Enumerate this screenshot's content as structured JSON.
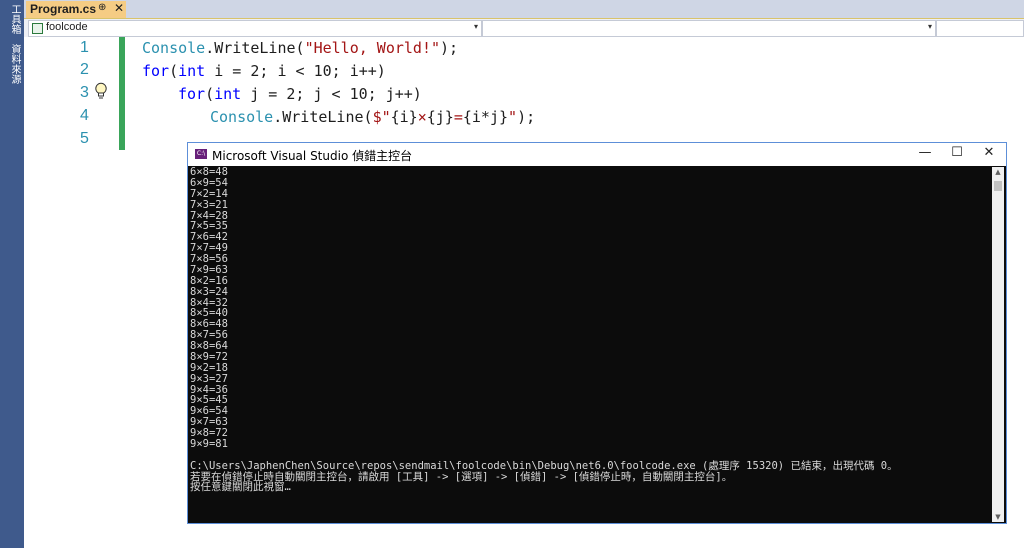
{
  "side_toolbar": {
    "items": [
      "工具箱",
      "資料來源"
    ]
  },
  "tab": {
    "title": "Program.cs",
    "pin_glyph": "⊕",
    "close_glyph": "✕"
  },
  "navigation": {
    "project": "foolcode",
    "member": "",
    "extra": ""
  },
  "editor": {
    "line_numbers": [
      "1",
      "2",
      "3",
      "4",
      "5"
    ],
    "lines": [
      {
        "class_name": "Console",
        "call": ".WriteLine(",
        "string": "\"Hello, World!\"",
        "end": ");"
      },
      {
        "kw1": "for",
        "open": "(",
        "kw2": "int",
        "rest": " i = 2; i < 10; i++)"
      },
      {
        "kw1": "for",
        "open": "(",
        "kw2": "int",
        "rest": " j = 2; j < 10; j++)"
      },
      {
        "class_name": "Console",
        "call": ".WriteLine(",
        "str_open": "$\"",
        "i1": "{i}",
        "times": "×",
        "i2": "{j}",
        "eq": "=",
        "i3": "{i*j}",
        "str_close": "\"",
        "end": ");"
      }
    ]
  },
  "console": {
    "app_badge": "C:\\",
    "title": "Microsoft Visual Studio 偵錯主控台",
    "buttons": {
      "minimize": "—",
      "maximize": "☐",
      "close": "✕"
    },
    "output_lines": [
      "6×8=48",
      "6×9=54",
      "7×2=14",
      "7×3=21",
      "7×4=28",
      "7×5=35",
      "7×6=42",
      "7×7=49",
      "7×8=56",
      "7×9=63",
      "8×2=16",
      "8×3=24",
      "8×4=32",
      "8×5=40",
      "8×6=48",
      "8×7=56",
      "8×8=64",
      "8×9=72",
      "9×2=18",
      "9×3=27",
      "9×4=36",
      "9×5=45",
      "9×6=54",
      "9×7=63",
      "9×8=72",
      "9×9=81",
      "",
      "C:\\Users\\JaphenChen\\Source\\repos\\sendmail\\foolcode\\bin\\Debug\\net6.0\\foolcode.exe (處理序 15320) 已結束，出現代碼 0。",
      "若要在偵錯停止時自動關閉主控台，請啟用 [工具] -> [選項] -> [偵錯] -> [偵錯停止時，自動關閉主控台]。",
      "按任意鍵關閉此視窗…"
    ]
  },
  "icons": {
    "lightbulb": "lightbulb-icon",
    "scroll_up": "▲",
    "scroll_down": "▼",
    "dropdown": "▾"
  },
  "colors": {
    "keyword": "#0000ff",
    "class_name": "#2b91af",
    "string": "#a31515",
    "active_tab": "#f5cc84",
    "console_bg": "#0c0c0c",
    "change_bar": "#3aa55a"
  }
}
